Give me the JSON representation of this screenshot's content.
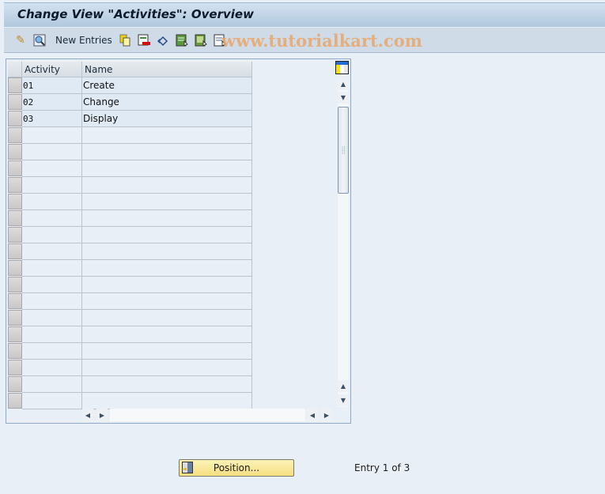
{
  "window": {
    "title": "Change View \"Activities\": Overview"
  },
  "toolbar": {
    "items": [
      {
        "name": "display-change-icon",
        "glyph": "✎"
      },
      {
        "name": "details-icon",
        "glyph": "🔍"
      },
      {
        "name": "new-entries",
        "label": "New Entries"
      },
      {
        "name": "copy-as-icon",
        "glyph": "⎘"
      },
      {
        "name": "delete-icon",
        "glyph": "▬"
      },
      {
        "name": "undo-change-icon",
        "glyph": "↶"
      },
      {
        "name": "select-all-icon",
        "glyph": "▤"
      },
      {
        "name": "select-block-icon",
        "glyph": "▦"
      },
      {
        "name": "deselect-all-icon",
        "glyph": "▥"
      }
    ],
    "new_entries_label": "New Entries"
  },
  "watermark": "www.tutorialkart.com",
  "table": {
    "columns": [
      "Activity",
      "Name"
    ],
    "rows": [
      {
        "activity": "01",
        "name": "Create"
      },
      {
        "activity": "02",
        "name": "Change"
      },
      {
        "activity": "03",
        "name": "Display"
      }
    ],
    "visible_row_count": 20
  },
  "footer": {
    "position_button": "Position...",
    "entry_status": "Entry 1 of 3"
  }
}
